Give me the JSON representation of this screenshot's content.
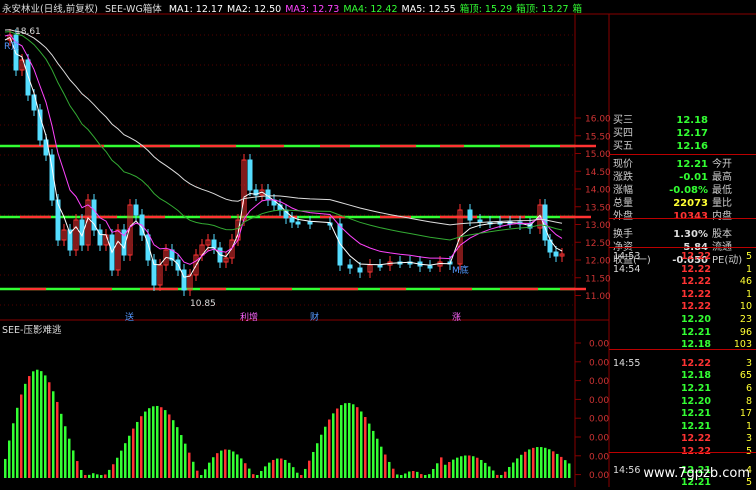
{
  "header": {
    "stock": "永安林业(日线,前复权)",
    "indicator": "SEE-WG箱体",
    "ma": [
      {
        "label": "MA1: 12.17",
        "color": "#ffffff"
      },
      {
        "label": "MA2: 12.50",
        "color": "#ffffff"
      },
      {
        "label": "MA3: 12.73",
        "color": "#ff44ff"
      },
      {
        "label": "MA4: 12.42",
        "color": "#33ff33"
      },
      {
        "label": "MA5: 12.55",
        "color": "#ffffff"
      },
      {
        "label": "箱顶: 15.29",
        "color": "#33ff33"
      },
      {
        "label": "箱顶: 13.27",
        "color": "#33ff33"
      },
      {
        "label": "箱",
        "color": "#33ff33"
      }
    ]
  },
  "indicator_title": "SEE-压影难逃",
  "price_axis": [
    "16.00",
    "15.50",
    "15.00",
    "14.50",
    "14.00",
    "13.50",
    "13.00",
    "12.50",
    "12.00",
    "11.50",
    "11.00"
  ],
  "lower_axis": [
    "0.00",
    "0.00",
    "0.00",
    "0.00",
    "0.00",
    "0.00",
    "0.00",
    "0.00",
    "0.00"
  ],
  "annotations": {
    "high": "18.61",
    "low": "10.85",
    "r_top": "R顶",
    "m_bottom": "M底",
    "events": [
      "送",
      "利增",
      "财",
      "涨"
    ]
  },
  "quote": [
    {
      "label": "买三",
      "value": "12.18",
      "vcolor": "#33ff33",
      "right": ""
    },
    {
      "label": "买四",
      "value": "12.17",
      "vcolor": "#33ff33",
      "right": ""
    },
    {
      "label": "买五",
      "value": "12.16",
      "vcolor": "#33ff33",
      "right": ""
    },
    {
      "label": "现价",
      "value": "12.21",
      "vcolor": "#33ff33",
      "right": "今开"
    },
    {
      "label": "涨跌",
      "value": "-0.01",
      "vcolor": "#33ff33",
      "right": "最高"
    },
    {
      "label": "涨幅",
      "value": "-0.08%",
      "vcolor": "#33ff33",
      "right": "最低"
    },
    {
      "label": "总量",
      "value": "22073",
      "vcolor": "#ffff33",
      "right": "量比"
    },
    {
      "label": "外盘",
      "value": "10343",
      "vcolor": "#ff3333",
      "right": "内盘"
    },
    {
      "label": "换手",
      "value": "1.30%",
      "vcolor": "#dddddd",
      "right": "股本"
    },
    {
      "label": "净资",
      "value": "5.84",
      "vcolor": "#dddddd",
      "right": "流通"
    },
    {
      "label": "收益(一)",
      "value": "-0.050",
      "vcolor": "#dddddd",
      "right": "PE(动)"
    }
  ],
  "ticks": [
    {
      "time": "14:53",
      "price": "12.22",
      "vol": "5"
    },
    {
      "time": "14:54",
      "price": "12.22",
      "vol": "1"
    },
    {
      "time": "",
      "price": "12.22",
      "vol": "46"
    },
    {
      "time": "",
      "price": "12.22",
      "vol": "1"
    },
    {
      "time": "",
      "price": "12.22",
      "vol": "10"
    },
    {
      "time": "",
      "price": "12.20",
      "vol": "23"
    },
    {
      "time": "",
      "price": "12.21",
      "vol": "96"
    },
    {
      "time": "",
      "price": "12.18",
      "vol": "103"
    },
    {
      "time": "14:55",
      "price": "12.22",
      "vol": "3"
    },
    {
      "time": "",
      "price": "12.18",
      "vol": "65"
    },
    {
      "time": "",
      "price": "12.21",
      "vol": "6"
    },
    {
      "time": "",
      "price": "12.20",
      "vol": "8"
    },
    {
      "time": "",
      "price": "12.21",
      "vol": "17"
    },
    {
      "time": "",
      "price": "12.21",
      "vol": "1"
    },
    {
      "time": "",
      "price": "12.22",
      "vol": "3"
    },
    {
      "time": "",
      "price": "12.22",
      "vol": "5"
    },
    {
      "time": "14:56",
      "price": "12.21",
      "vol": "4"
    },
    {
      "time": "",
      "price": "12.21",
      "vol": "5"
    }
  ],
  "watermark": "www.7gpzb.com",
  "colors": {
    "up": "#ff3333",
    "down": "#33ff33",
    "bg": "#000000",
    "grid": "#880000",
    "box": "#33ff33"
  }
}
